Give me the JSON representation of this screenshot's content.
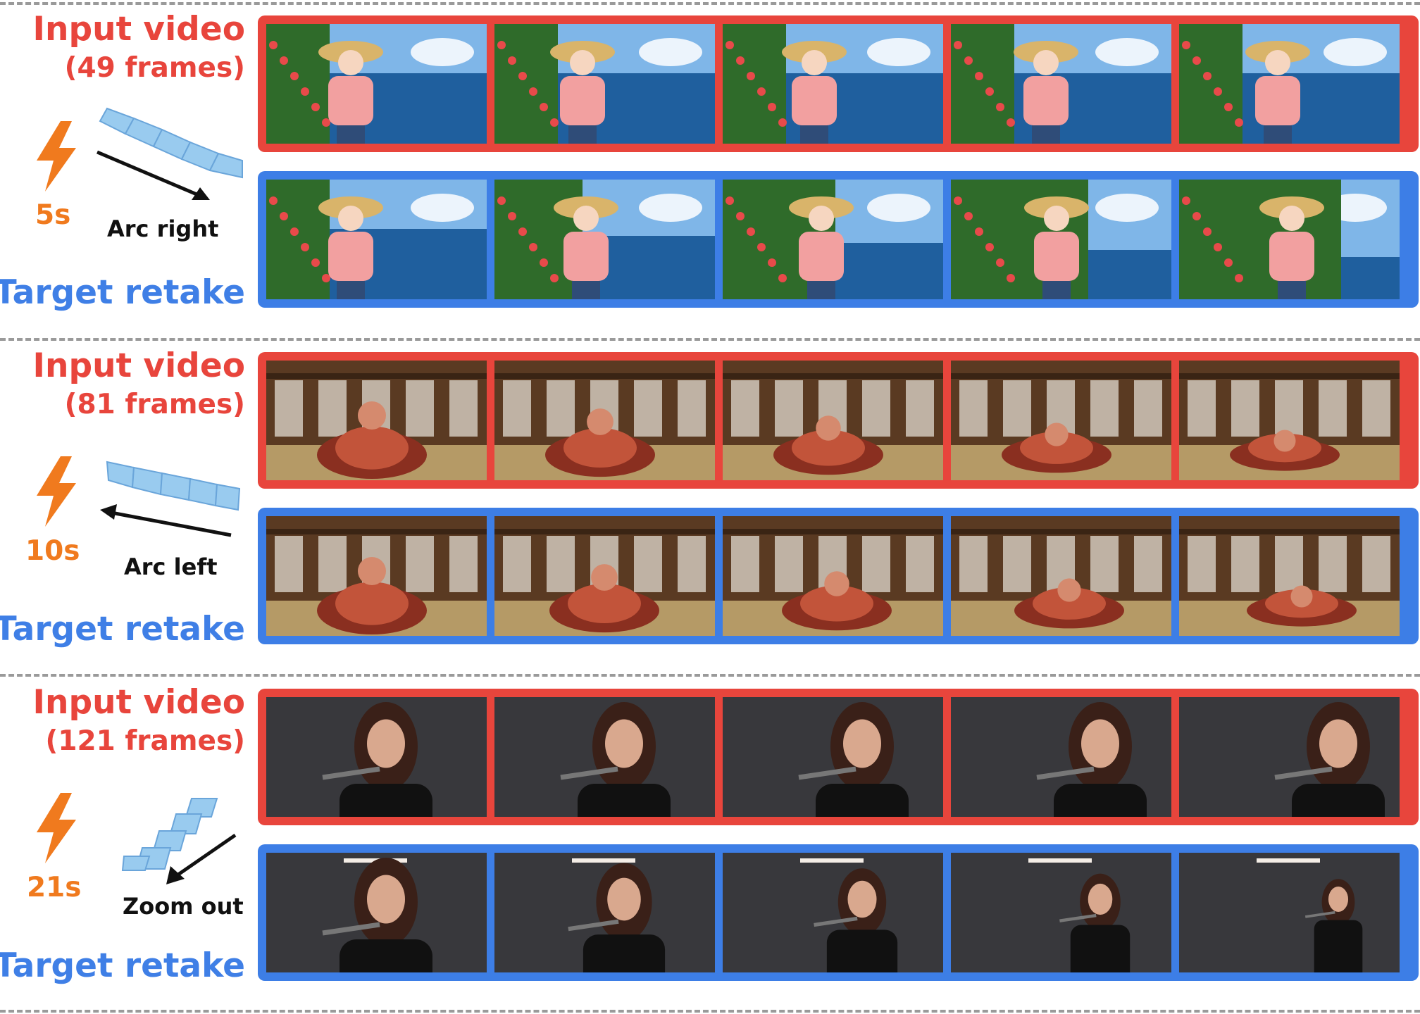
{
  "rows": [
    {
      "input_title": "Input video",
      "input_frames": "(49 frames)",
      "target_title": "Target retake",
      "time": "5s",
      "camera": "Arc right",
      "scene": "beach",
      "colors": {
        "sky": "#7fb6e8",
        "sea": "#1f5f9e",
        "foliage": "#2f6b2a",
        "accent": "#e84a4a",
        "subject": "#f2a0a0",
        "hat": "#d9b46a"
      }
    },
    {
      "input_title": "Input video",
      "input_frames": "(81 frames)",
      "target_title": "Target retake",
      "time": "10s",
      "camera": "Arc left",
      "scene": "dojo",
      "colors": {
        "wall": "#5a3a22",
        "window": "#e9e6dc",
        "floor": "#b59a66",
        "subject": "#c2543a",
        "shade": "#8a2f20"
      }
    },
    {
      "input_title": "Input video",
      "input_frames": "(121 frames)",
      "target_title": "Target retake",
      "time": "21s",
      "camera": "Zoom out",
      "scene": "stage",
      "colors": {
        "bg": "#2c2c30",
        "haze": "#4a4a50",
        "hair": "#3a2018",
        "skin": "#d9a88e",
        "shirt": "#111111",
        "light": "#f4ede6"
      }
    }
  ],
  "colors": {
    "input_border": "#e8453c",
    "target_border": "#3d7ee6",
    "time": "#f07a1e",
    "divider": "#9a9a9a"
  },
  "icons": [
    "lightning-bolt-icon",
    "camera-trajectory-icon",
    "direction-arrow-icon"
  ]
}
